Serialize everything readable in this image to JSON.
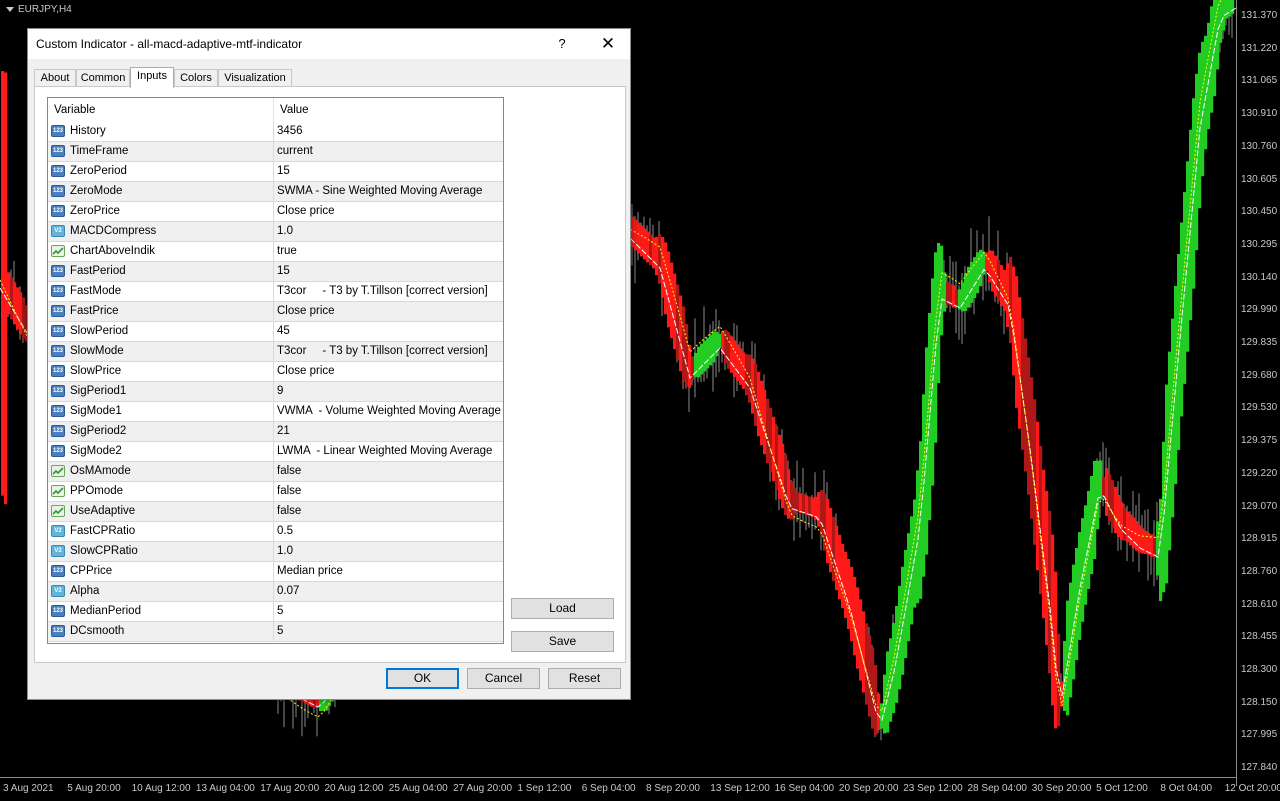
{
  "chart": {
    "symbol": "EURJPY,H4",
    "price_ticks": [
      "131.370",
      "131.220",
      "131.065",
      "130.910",
      "130.760",
      "130.605",
      "130.450",
      "130.295",
      "130.140",
      "129.990",
      "129.835",
      "129.680",
      "129.530",
      "129.375",
      "129.220",
      "129.070",
      "128.915",
      "128.760",
      "128.610",
      "128.455",
      "128.300",
      "128.150",
      "127.995",
      "127.840"
    ],
    "time_ticks": [
      "3 Aug 2021",
      "5 Aug 20:00",
      "10 Aug 12:00",
      "13 Aug 04:00",
      "17 Aug 20:00",
      "20 Aug 12:00",
      "25 Aug 04:00",
      "27 Aug 20:00",
      "1 Sep 12:00",
      "6 Sep 04:00",
      "8 Sep 20:00",
      "13 Sep 12:00",
      "16 Sep 04:00",
      "20 Sep 20:00",
      "23 Sep 12:00",
      "28 Sep 04:00",
      "30 Sep 20:00",
      "5 Oct 12:00",
      "8 Oct 04:00",
      "12 Oct 20:00"
    ],
    "colors": {
      "bull": "#22cc22",
      "bear": "#ff1a1a",
      "bear_dark": "#b01818",
      "candle": "#8c8c8c",
      "line": "#ffffff",
      "dotted": "#ffff00"
    }
  },
  "dialog": {
    "title": "Custom Indicator - all-macd-adaptive-mtf-indicator",
    "help": "?",
    "close": "✕",
    "tabs": [
      {
        "label": "About",
        "active": false
      },
      {
        "label": "Common",
        "active": false
      },
      {
        "label": "Inputs",
        "active": true
      },
      {
        "label": "Colors",
        "active": false
      },
      {
        "label": "Visualization",
        "active": false
      }
    ],
    "grid": {
      "header": {
        "variable": "Variable",
        "value": "Value"
      },
      "rows": [
        {
          "type": "int",
          "name": "History",
          "value": "3456"
        },
        {
          "type": "int",
          "name": "TimeFrame",
          "value": "current"
        },
        {
          "type": "int",
          "name": "ZeroPeriod",
          "value": "15"
        },
        {
          "type": "int",
          "name": "ZeroMode",
          "value": "SWMA - Sine Weighted Moving Average"
        },
        {
          "type": "int",
          "name": "ZeroPrice",
          "value": "Close price"
        },
        {
          "type": "dbl",
          "name": "MACDCompress",
          "value": "1.0"
        },
        {
          "type": "bool",
          "name": "ChartAboveIndik",
          "value": "true"
        },
        {
          "type": "int",
          "name": "FastPeriod",
          "value": "15"
        },
        {
          "type": "int",
          "name": "FastMode",
          "value": "T3cor     - T3 by T.Tillson [correct version]"
        },
        {
          "type": "int",
          "name": "FastPrice",
          "value": "Close price"
        },
        {
          "type": "int",
          "name": "SlowPeriod",
          "value": "45"
        },
        {
          "type": "int",
          "name": "SlowMode",
          "value": "T3cor     - T3 by T.Tillson [correct version]"
        },
        {
          "type": "int",
          "name": "SlowPrice",
          "value": "Close price"
        },
        {
          "type": "int",
          "name": "SigPeriod1",
          "value": "9"
        },
        {
          "type": "int",
          "name": "SigMode1",
          "value": "VWMA  - Volume Weighted Moving Average"
        },
        {
          "type": "int",
          "name": "SigPeriod2",
          "value": "21"
        },
        {
          "type": "int",
          "name": "SigMode2",
          "value": "LWMA  - Linear Weighted Moving Average"
        },
        {
          "type": "bool",
          "name": "OsMAmode",
          "value": "false"
        },
        {
          "type": "bool",
          "name": "PPOmode",
          "value": "false"
        },
        {
          "type": "bool",
          "name": "UseAdaptive",
          "value": "false"
        },
        {
          "type": "dbl",
          "name": "FastCPRatio",
          "value": "0.5"
        },
        {
          "type": "dbl",
          "name": "SlowCPRatio",
          "value": "1.0"
        },
        {
          "type": "int",
          "name": "CPPrice",
          "value": "Median price"
        },
        {
          "type": "dbl",
          "name": "Alpha",
          "value": "0.07"
        },
        {
          "type": "int",
          "name": "MedianPeriod",
          "value": "5"
        },
        {
          "type": "int",
          "name": "DCsmooth",
          "value": "5"
        }
      ]
    },
    "buttons": {
      "load": "Load",
      "save": "Save",
      "ok": "OK",
      "cancel": "Cancel",
      "reset": "Reset"
    }
  }
}
